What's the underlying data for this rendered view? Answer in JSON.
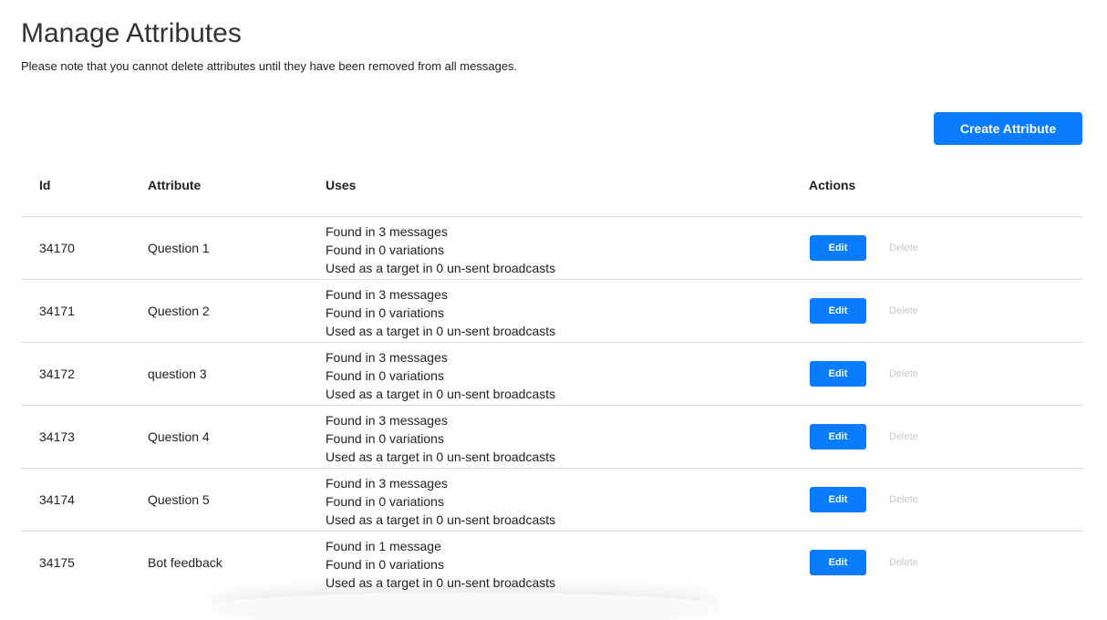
{
  "page": {
    "title": "Manage Attributes",
    "note": "Please note that you cannot delete attributes until they have been removed from all messages.",
    "create_button": "Create Attribute"
  },
  "table": {
    "headers": {
      "id": "Id",
      "attribute": "Attribute",
      "uses": "Uses",
      "actions": "Actions"
    },
    "rows": [
      {
        "id": "34170",
        "attribute": "Question 1",
        "uses": [
          "Found in 3 messages",
          "Found in 0 variations",
          "Used as a target in 0 un-sent broadcasts"
        ],
        "edit": "Edit",
        "delete": "Delete"
      },
      {
        "id": "34171",
        "attribute": "Question 2",
        "uses": [
          "Found in 3 messages",
          "Found in 0 variations",
          "Used as a target in 0 un-sent broadcasts"
        ],
        "edit": "Edit",
        "delete": "Delete"
      },
      {
        "id": "34172",
        "attribute": "question 3",
        "uses": [
          "Found in 3 messages",
          "Found in 0 variations",
          "Used as a target in 0 un-sent broadcasts"
        ],
        "edit": "Edit",
        "delete": "Delete"
      },
      {
        "id": "34173",
        "attribute": "Question 4",
        "uses": [
          "Found in 3 messages",
          "Found in 0 variations",
          "Used as a target in 0 un-sent broadcasts"
        ],
        "edit": "Edit",
        "delete": "Delete"
      },
      {
        "id": "34174",
        "attribute": "Question 5",
        "uses": [
          "Found in 3 messages",
          "Found in 0 variations",
          "Used as a target in 0 un-sent broadcasts"
        ],
        "edit": "Edit",
        "delete": "Delete"
      },
      {
        "id": "34175",
        "attribute": "Bot feedback",
        "uses": [
          "Found in 1 message",
          "Found in 0 variations",
          "Used as a target in 0 un-sent broadcasts"
        ],
        "edit": "Edit",
        "delete": "Delete"
      }
    ]
  },
  "colors": {
    "accent": "#0a7cff",
    "disabled_text": "#c8c8c8",
    "divider": "#dddddd"
  }
}
